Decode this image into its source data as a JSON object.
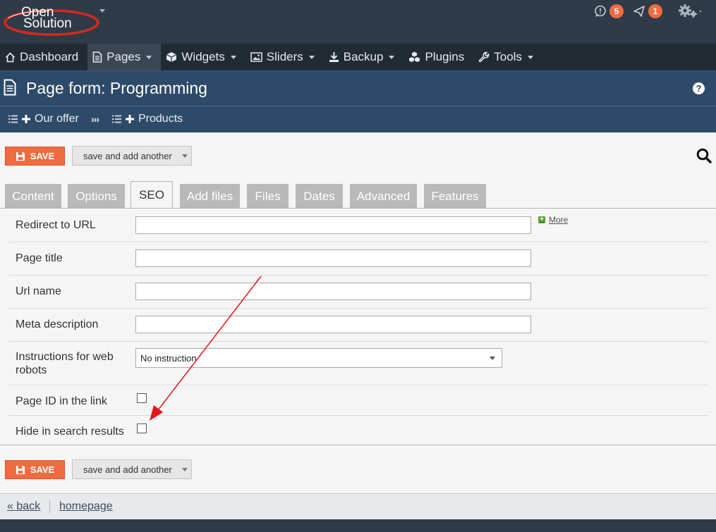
{
  "logo": {
    "line1": "Open",
    "line2": "Solution"
  },
  "top": {
    "messages_count": "5",
    "notifications_count": "1"
  },
  "nav": {
    "items": [
      {
        "label": "Dashboard",
        "icon": "home-icon"
      },
      {
        "label": "Pages",
        "icon": "page-icon"
      },
      {
        "label": "Widgets",
        "icon": "cube-icon"
      },
      {
        "label": "Sliders",
        "icon": "image-icon"
      },
      {
        "label": "Backup",
        "icon": "download-icon"
      },
      {
        "label": "Plugins",
        "icon": "cubes-icon"
      },
      {
        "label": "Tools",
        "icon": "wrench-icon"
      }
    ]
  },
  "header": {
    "title": "Page form: Programming"
  },
  "breadcrumb": {
    "item1": "Our offer",
    "separator": "›››",
    "item2": "Products"
  },
  "actions": {
    "save_label": "SAVE",
    "save_another_label": "save and add another"
  },
  "tabs": [
    "Content",
    "Options",
    "SEO",
    "Add files",
    "Files",
    "Dates",
    "Advanced",
    "Features"
  ],
  "form": {
    "redirect_label": "Redirect to URL",
    "more_label": "More",
    "page_title_label": "Page title",
    "url_name_label": "Url name",
    "meta_description_label": "Meta description",
    "robots_label": "Instructions for web robots",
    "robots_value": "No instruction",
    "page_id_label": "Page ID in the link",
    "hide_search_label": "Hide in search results"
  },
  "footer": {
    "back_label": "« back",
    "homepage_label": "homepage"
  },
  "colors": {
    "accent": "#ef6c41",
    "header": "#2e4a69",
    "topbar": "#2f3b48",
    "navbar": "#222a33"
  }
}
